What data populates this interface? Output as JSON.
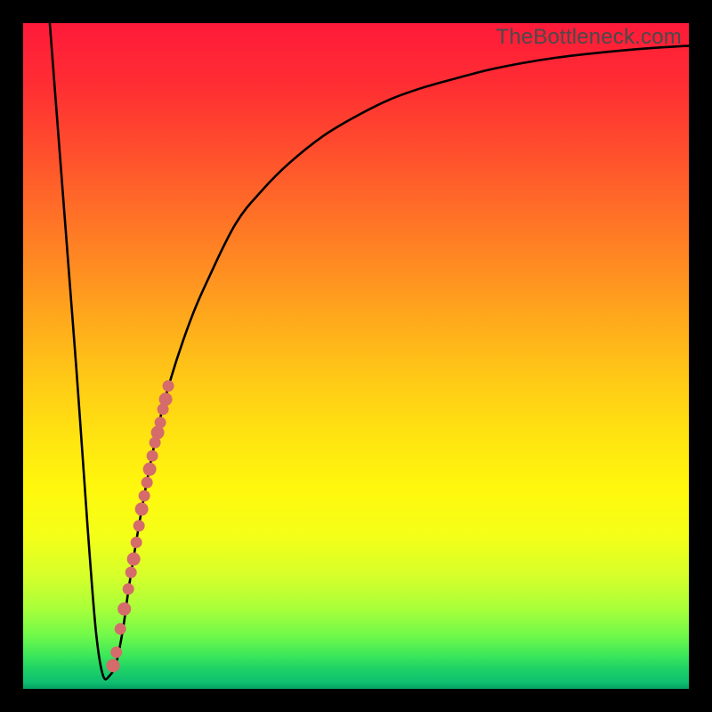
{
  "watermark": "TheBottleneck.com",
  "colors": {
    "background": "#000000",
    "curve": "#000000",
    "dot": "#d56b6b",
    "gradient_top": "#ff1a3a",
    "gradient_bottom": "#05a060"
  },
  "chart_data": {
    "type": "line",
    "title": "",
    "xlabel": "",
    "ylabel": "",
    "xlim": [
      0,
      100
    ],
    "ylim": [
      0,
      100
    ],
    "series": [
      {
        "name": "bottleneck-curve",
        "x": [
          4,
          5,
          6,
          7,
          8,
          9,
          10,
          11,
          12,
          13,
          14,
          15,
          16,
          18,
          20,
          22,
          25,
          28,
          32,
          36,
          40,
          45,
          50,
          55,
          60,
          65,
          70,
          75,
          80,
          85,
          90,
          95,
          100
        ],
        "y": [
          100,
          87,
          74,
          61,
          48,
          34,
          20,
          8,
          2,
          2,
          4,
          9,
          16,
          28,
          38,
          46,
          55,
          62,
          70,
          75,
          79,
          83,
          86,
          88.5,
          90.3,
          91.7,
          93,
          94,
          94.8,
          95.4,
          95.9,
          96.3,
          96.6
        ]
      }
    ],
    "markers": {
      "name": "highlighted-points",
      "x": [
        13.5,
        14.0,
        14.6,
        15.2,
        15.8,
        16.2,
        16.6,
        17.0,
        17.4,
        17.8,
        18.2,
        18.6,
        19.0,
        19.4,
        19.8,
        20.2,
        20.6,
        21.0,
        21.4,
        21.8
      ],
      "y": [
        3.5,
        5.5,
        9.0,
        12.0,
        15.0,
        17.5,
        19.5,
        22.0,
        24.5,
        27.0,
        29.0,
        31.0,
        33.0,
        35.0,
        37.0,
        38.5,
        40.0,
        42.0,
        43.5,
        45.5
      ]
    }
  }
}
